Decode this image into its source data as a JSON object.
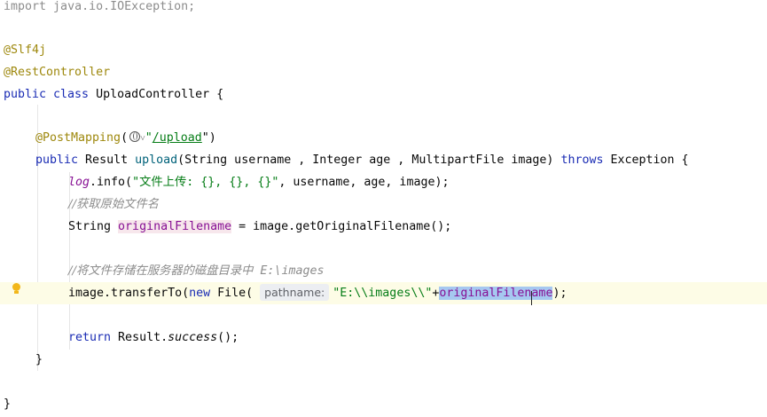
{
  "editor": {
    "lines": {
      "import": {
        "kw": "import",
        "rest": " java.io.IOException;"
      },
      "ann1": "@Slf4j",
      "ann2": "@RestController",
      "class_decl": {
        "kw": "public class",
        "rest": " UploadController {"
      },
      "mapping": {
        "ann": "@PostMapping",
        "open": "(",
        "chevron": "˅",
        "quote_open": "\"",
        "path": "/upload",
        "quote_close": "\")"
      },
      "method": {
        "kw": "public",
        "type": " Result ",
        "name": "upload",
        "params": "(String username , Integer age , MultipartFile image) ",
        "throws": "throws",
        "tail": " Exception {"
      },
      "log": {
        "var": "log",
        "call": ".info(",
        "str": "\"文件上传: {}, {}, {}\"",
        "args": ", username, age, image);"
      },
      "comment1": "//获取原始文件名",
      "filename": {
        "type": "String ",
        "var": "originalFilename",
        "rest": " = image.getOriginalFilename();"
      },
      "comment2": {
        "zh": "//将文件存储在服务器的磁盘目录中",
        "path": " E:\\images"
      },
      "transfer": {
        "head": "image.transferTo(",
        "kw": "new",
        "mid": " File( ",
        "hint": "pathname:",
        "str": "\"E:\\\\images\\\\\"",
        "plus": "+",
        "selected": "originalFilename",
        "tail": ");"
      },
      "return": {
        "kw": "return",
        "mid": " Result.",
        "call": "success",
        "tail": "();"
      },
      "close_method": "}",
      "close_class": "}"
    }
  }
}
